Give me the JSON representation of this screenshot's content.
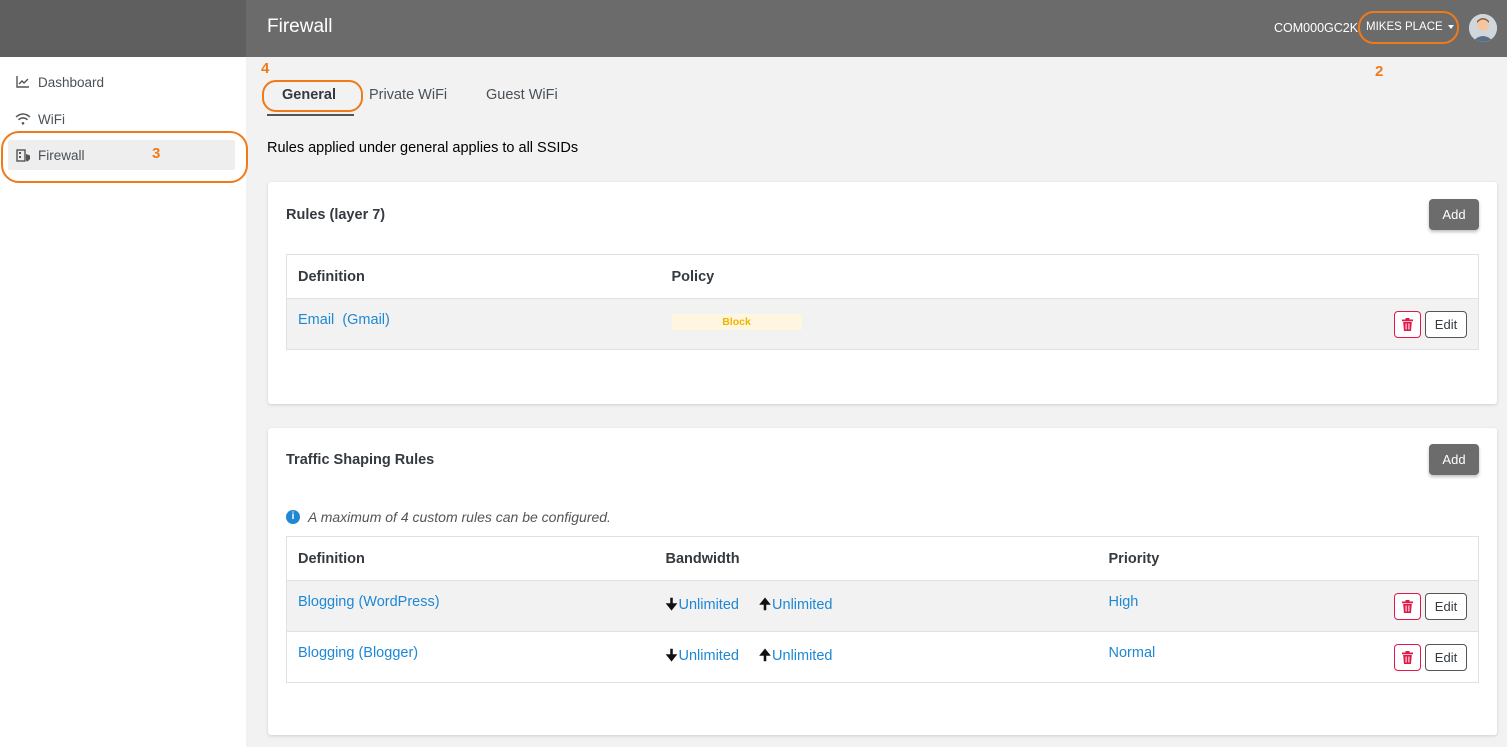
{
  "header": {
    "title": "Firewall",
    "account_id": "COM000GC2K",
    "location": "MIKES PLACE"
  },
  "sidebar": {
    "items": [
      {
        "label": "Dashboard",
        "icon": "chart-line-icon"
      },
      {
        "label": "WiFi",
        "icon": "wifi-icon"
      },
      {
        "label": "Firewall",
        "icon": "firewall-icon",
        "active": true
      }
    ]
  },
  "annotations": [
    "2",
    "3",
    "4"
  ],
  "tabs": [
    {
      "label": "General",
      "active": true
    },
    {
      "label": "Private WiFi"
    },
    {
      "label": "Guest WiFi"
    }
  ],
  "general_note": "Rules applied under general applies to all SSIDs",
  "layer7": {
    "title": "Rules (layer 7)",
    "add_label": "Add",
    "columns": [
      "Definition",
      "Policy"
    ],
    "rows": [
      {
        "definition": "Email  (Gmail)",
        "policy": "Block",
        "edit_label": "Edit"
      }
    ]
  },
  "traffic": {
    "title": "Traffic Shaping Rules",
    "add_label": "Add",
    "note": "A maximum of 4 custom rules can be configured.",
    "columns": [
      "Definition",
      "Bandwidth",
      "Priority"
    ],
    "rows": [
      {
        "definition": "Blogging (WordPress)",
        "down": "Unlimited",
        "up": "Unlimited",
        "priority": "High",
        "edit_label": "Edit"
      },
      {
        "definition": "Blogging (Blogger)",
        "down": "Unlimited",
        "up": "Unlimited",
        "priority": "Normal",
        "edit_label": "Edit"
      }
    ]
  },
  "colors": {
    "accent_link": "#1e88d4",
    "annotation": "#f07a1a",
    "delete": "#e0194a",
    "block_badge_text": "#f0b400"
  }
}
